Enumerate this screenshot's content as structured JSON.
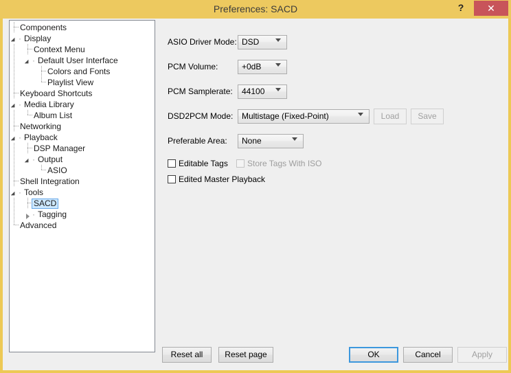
{
  "window": {
    "title": "Preferences: SACD",
    "help_label": "?",
    "close_label": "✕"
  },
  "tree": {
    "nodes": [
      {
        "label": "Components",
        "depth": 0,
        "state": "leaf",
        "selected": false
      },
      {
        "label": "Display",
        "depth": 0,
        "state": "expanded",
        "selected": false
      },
      {
        "label": "Context Menu",
        "depth": 1,
        "state": "leaf",
        "selected": false
      },
      {
        "label": "Default User Interface",
        "depth": 1,
        "state": "expanded",
        "selected": false
      },
      {
        "label": "Colors and Fonts",
        "depth": 2,
        "state": "leaf",
        "selected": false
      },
      {
        "label": "Playlist View",
        "depth": 2,
        "state": "last-leaf",
        "selected": false
      },
      {
        "label": "Keyboard Shortcuts",
        "depth": 0,
        "state": "leaf",
        "selected": false
      },
      {
        "label": "Media Library",
        "depth": 0,
        "state": "expanded",
        "selected": false
      },
      {
        "label": "Album List",
        "depth": 1,
        "state": "last-leaf",
        "selected": false
      },
      {
        "label": "Networking",
        "depth": 0,
        "state": "leaf",
        "selected": false
      },
      {
        "label": "Playback",
        "depth": 0,
        "state": "expanded",
        "selected": false
      },
      {
        "label": "DSP Manager",
        "depth": 1,
        "state": "leaf",
        "selected": false
      },
      {
        "label": "Output",
        "depth": 1,
        "state": "expanded",
        "selected": false
      },
      {
        "label": "ASIO",
        "depth": 2,
        "state": "last-leaf",
        "selected": false
      },
      {
        "label": "Shell Integration",
        "depth": 0,
        "state": "leaf",
        "selected": false
      },
      {
        "label": "Tools",
        "depth": 0,
        "state": "expanded",
        "selected": false
      },
      {
        "label": "SACD",
        "depth": 1,
        "state": "leaf",
        "selected": true
      },
      {
        "label": "Tagging",
        "depth": 1,
        "state": "collapsed",
        "selected": false
      },
      {
        "label": "Advanced",
        "depth": 0,
        "state": "last-leaf",
        "selected": false
      }
    ]
  },
  "form": {
    "fields": [
      {
        "label": "ASIO Driver Mode:",
        "value": "DSD"
      },
      {
        "label": "PCM Volume:",
        "value": "+0dB"
      },
      {
        "label": "PCM Samplerate:",
        "value": "44100"
      },
      {
        "label": "DSD2PCM Mode:",
        "value": "Multistage (Fixed-Point)"
      },
      {
        "label": "Preferable Area:",
        "value": "None"
      }
    ],
    "load_label": "Load",
    "save_label": "Save",
    "checkboxes": [
      {
        "label": "Editable Tags",
        "checked": false,
        "disabled": false
      },
      {
        "label": "Store Tags With ISO",
        "checked": false,
        "disabled": true
      },
      {
        "label": "Edited Master Playback",
        "checked": false,
        "disabled": false
      }
    ]
  },
  "footer": {
    "reset_all": "Reset all",
    "reset_page": "Reset page",
    "ok": "OK",
    "cancel": "Cancel",
    "apply": "Apply"
  },
  "colors": {
    "titlebar": "#edc95f",
    "close": "#c8545a",
    "selection": "#cde8ff",
    "selection_border": "#66a7e8",
    "focus_border": "#3c97dd",
    "panel_bg": "#efefef"
  }
}
